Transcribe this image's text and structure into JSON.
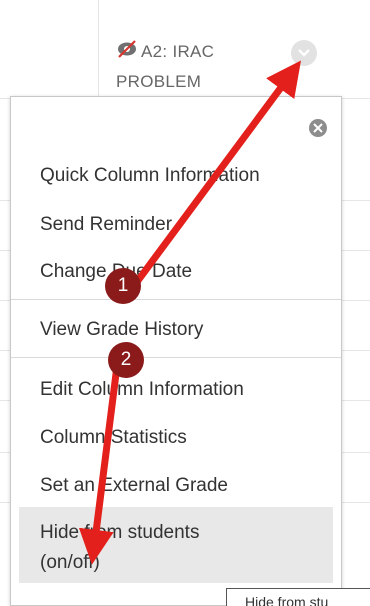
{
  "column": {
    "title_line1": "A2: IRAC",
    "title_line2": "PROBLEM"
  },
  "menu": {
    "items": [
      {
        "label": "Quick Column Information"
      },
      {
        "label": "Send Reminder"
      },
      {
        "label": "Change Due Date"
      },
      {
        "label": "View Grade History"
      },
      {
        "label": "Edit Column Information"
      },
      {
        "label": "Column Statistics"
      },
      {
        "label": "Set an External Grade"
      },
      {
        "label": "Hide from students (on/off)"
      }
    ]
  },
  "tooltip": {
    "text": "Hide from stu"
  },
  "annotations": {
    "badge1": "1",
    "badge2": "2",
    "arrow_color": "#e3201b",
    "badge_color": "#8b1a1a"
  }
}
